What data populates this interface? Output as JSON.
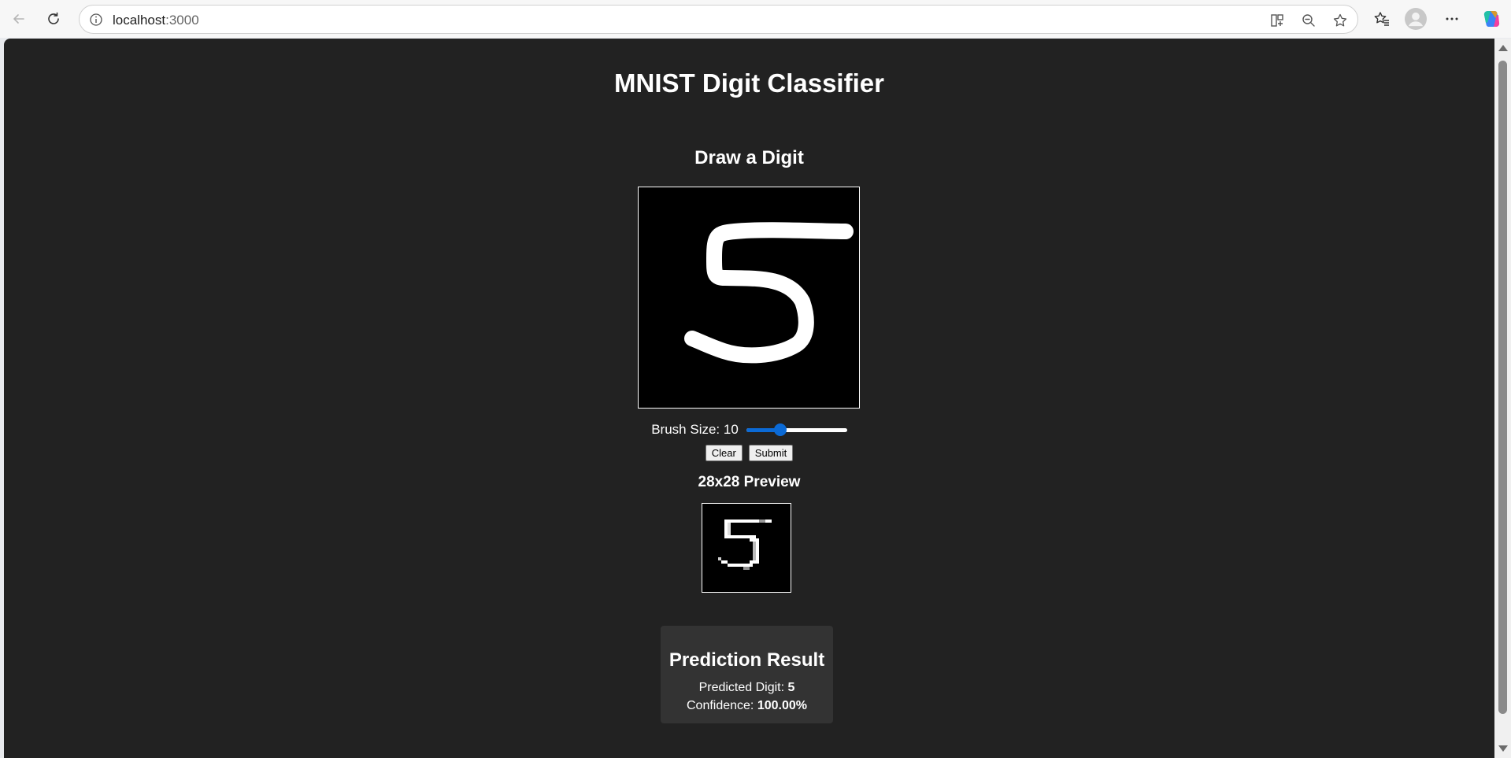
{
  "browser": {
    "url_host": "localhost",
    "url_port": ":3000",
    "icons": [
      "back-icon",
      "refresh-icon",
      "info-icon",
      "split-screen-icon",
      "zoom-out-icon",
      "favorite-star-icon",
      "favorites-icon",
      "profile-icon",
      "more-icon",
      "copilot-icon"
    ]
  },
  "page": {
    "title": "MNIST Digit Classifier",
    "draw_section_title": "Draw a Digit",
    "brush": {
      "label": "Brush Size: 10",
      "value": 10,
      "min": 1,
      "max": 30
    },
    "buttons": {
      "clear_label": "Clear",
      "submit_label": "Submit"
    },
    "preview_title": "28x28 Preview",
    "result": {
      "title": "Prediction Result",
      "predicted_label": "Predicted Digit: ",
      "predicted_value": "5",
      "confidence_label": "Confidence: ",
      "confidence_value": "100.00%"
    }
  },
  "colors": {
    "page_background": "#222222",
    "result_background": "#333333",
    "slider_accent": "#0b6ad6",
    "text": "#ffffff"
  }
}
